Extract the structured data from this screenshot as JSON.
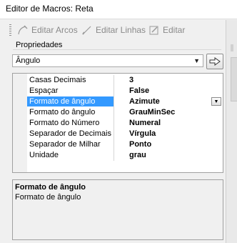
{
  "window": {
    "title": "Editor de Macros: Reta"
  },
  "toolbar": {
    "edit_arcs": "Editar Arcos",
    "edit_lines": "Editar Linhas",
    "edit": "Editar",
    "disabled_color": "#8a8a8a"
  },
  "properties": {
    "group_label": "Propriedades",
    "selected_object": "Ângulo",
    "rows": [
      {
        "name": "Casas Decimais",
        "value": "3"
      },
      {
        "name": "Espaçar",
        "value": "False"
      },
      {
        "name": "Formato de ângulo",
        "value": "Azimute"
      },
      {
        "name": "Formato do ângulo",
        "value": "GrauMinSec"
      },
      {
        "name": "Formato do Número",
        "value": "Numeral"
      },
      {
        "name": "Separador de Decimais",
        "value": "Vírgula"
      },
      {
        "name": "Separador de Milhar",
        "value": "Ponto"
      },
      {
        "name": "Unidade",
        "value": "grau"
      }
    ],
    "selected_row": 2,
    "selection_color": "#3399ff"
  },
  "description": {
    "title": "Formato de ângulo",
    "text": "Formato de ângulo"
  }
}
